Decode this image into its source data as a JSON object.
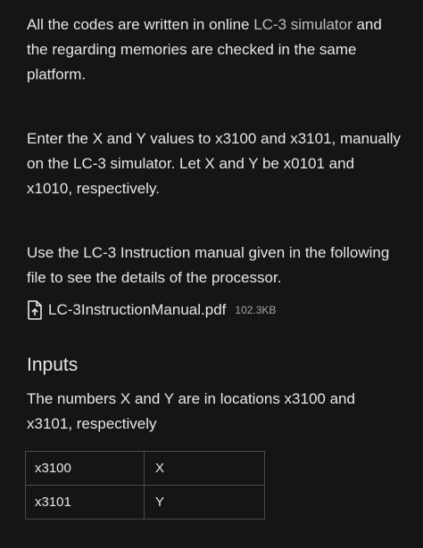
{
  "paragraphs": {
    "p1_before": "All the codes are written in online ",
    "p1_link": "LC-3 simulator",
    "p1_after": " and the regarding memories are checked in the same platform.",
    "p2": "Enter the X and Y values to x3100 and x3101, manually on the LC-3 simulator. Let X and Y be x0101 and x1010, respectively.",
    "p3": "Use the LC-3 Instruction manual given in the following file to see the details of the processor."
  },
  "attachment": {
    "icon": "pdf-file-icon",
    "name": "LC-3InstructionManual.pdf",
    "size": "102.3KB"
  },
  "inputs": {
    "heading": "Inputs",
    "description": "The numbers X and Y are in locations x3100 and x3101, respectively",
    "table": [
      {
        "location": "x3100",
        "value": "X"
      },
      {
        "location": "x3101",
        "value": "Y"
      }
    ]
  },
  "colors": {
    "background": "#151515",
    "text": "#e6e6e6",
    "link": "#bdbdbd",
    "border": "#4a4a4a"
  }
}
